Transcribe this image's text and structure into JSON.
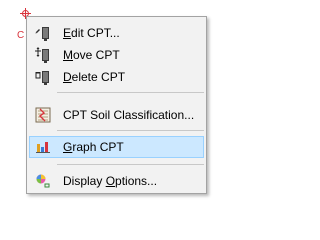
{
  "menu": {
    "items": [
      {
        "label": "Edit CPT...",
        "prefix": "",
        "mnemonic": "E",
        "suffix": "dit CPT...",
        "icon": "edit-cpt-icon"
      },
      {
        "label": "Move CPT",
        "prefix": "",
        "mnemonic": "M",
        "suffix": "ove CPT",
        "icon": "move-cpt-icon"
      },
      {
        "label": "Delete CPT",
        "prefix": "",
        "mnemonic": "D",
        "suffix": "elete CPT",
        "icon": "delete-cpt-icon"
      },
      {
        "label": "CPT Soil Classification...",
        "icon": "soil-classification-icon"
      },
      {
        "label": "Graph CPT",
        "prefix": "",
        "mnemonic": "G",
        "suffix": "raph CPT",
        "icon": "graph-cpt-icon",
        "highlighted": true
      },
      {
        "label": "Display Options...",
        "prefix": "Display ",
        "mnemonic": "O",
        "suffix": "ptions...",
        "icon": "display-options-icon"
      }
    ]
  },
  "cursor_marker": {
    "text": "C"
  },
  "colors": {
    "menu_bg": "#f2f2f2",
    "highlight_bg": "#cce8ff",
    "highlight_border": "#99d1ff",
    "marker": "#d8343c"
  }
}
